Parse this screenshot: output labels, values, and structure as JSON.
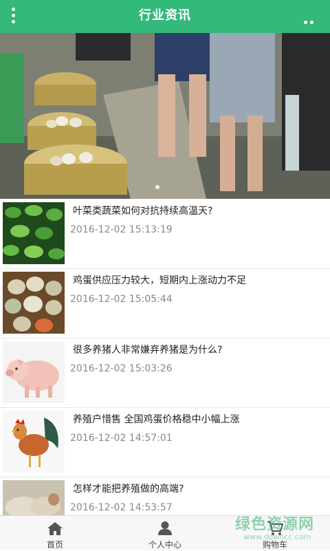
{
  "header": {
    "title": "行业资讯",
    "menu_icon": "menu-dots-vertical-icon",
    "more_icon": "more-dots-horizontal-icon",
    "background": "#33b97a"
  },
  "banner": {
    "description_icon": "banner-photo",
    "slide_index": 1
  },
  "news": [
    {
      "title": "叶菜类蔬菜如何对抗持续高温天?",
      "date": "2016-12-02 15:13:19",
      "thumb": "leafy-vegetables-thumb"
    },
    {
      "title": "鸡蛋供应压力较大，短期内上涨动力不足",
      "date": "2016-12-02 15:05:44",
      "thumb": "eggs-thumb"
    },
    {
      "title": "很多养猪人非常嫌弃养猪是为什么?",
      "date": "2016-12-02 15:03:26",
      "thumb": "piglet-thumb"
    },
    {
      "title": "养殖户惜售 全国鸡蛋价格稳中小幅上涨",
      "date": "2016-12-02 14:57:01",
      "thumb": "rooster-thumb"
    },
    {
      "title": "怎样才能把养殖做的高端?",
      "date": "2016-12-02 14:53:57",
      "thumb": "sheep-thumb"
    }
  ],
  "tabbar": {
    "home_label": "首页",
    "profile_label": "个人中心",
    "cart_label": "购物车",
    "home_icon": "home-icon",
    "profile_icon": "user-icon",
    "cart_icon": "cart-icon"
  },
  "watermark": {
    "text_cn": "绿色资源网",
    "text_en": "www.downcc.com"
  }
}
